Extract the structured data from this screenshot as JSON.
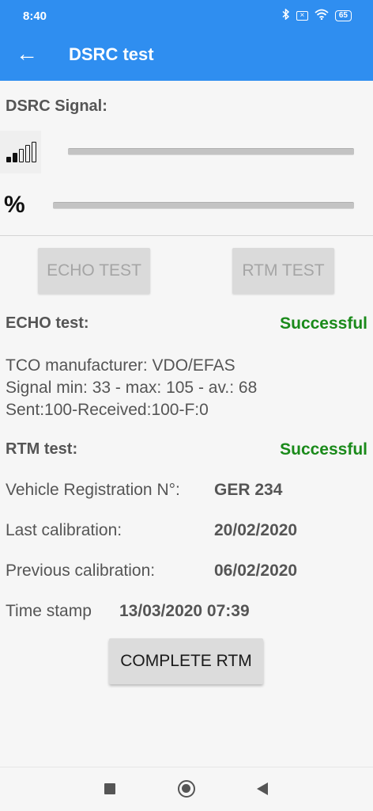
{
  "status_bar": {
    "time": "8:40",
    "battery": "65"
  },
  "app_bar": {
    "back_glyph": "←",
    "title": "DSRC test"
  },
  "signal": {
    "heading": "DSRC Signal:",
    "percent_symbol": "%",
    "strength_level": 0,
    "percent_level": 0
  },
  "buttons": {
    "echo_test": "ECHO TEST",
    "rtm_test": "RTM TEST",
    "complete_rtm": "COMPLETE RTM"
  },
  "echo": {
    "heading": "ECHO test:",
    "status": "Successful",
    "manufacturer": "TCO manufacturer: VDO/EFAS",
    "signal_stats": "Signal min: 33 - max: 105 - av.: 68",
    "packets": "Sent:100-Received:100-F:0"
  },
  "rtm": {
    "heading": "RTM test:",
    "status": "Successful",
    "vehicle_label": "Vehicle Registration N°:",
    "vehicle_value": "GER 234",
    "last_cal_label": "Last calibration:",
    "last_cal_value": "20/02/2020",
    "prev_cal_label": "Previous calibration:",
    "prev_cal_value": "06/02/2020",
    "timestamp_label": "Time stamp",
    "timestamp_value": "13/03/2020 07:39"
  },
  "colors": {
    "primary": "#2f8ef0",
    "success": "#1a8a1a",
    "background": "#f6f6f6"
  },
  "icons": [
    "back-arrow-icon",
    "bluetooth-icon",
    "sim-icon",
    "wifi-icon",
    "battery-icon",
    "signal-strength-icon",
    "recents-icon",
    "home-icon",
    "nav-back-icon"
  ]
}
